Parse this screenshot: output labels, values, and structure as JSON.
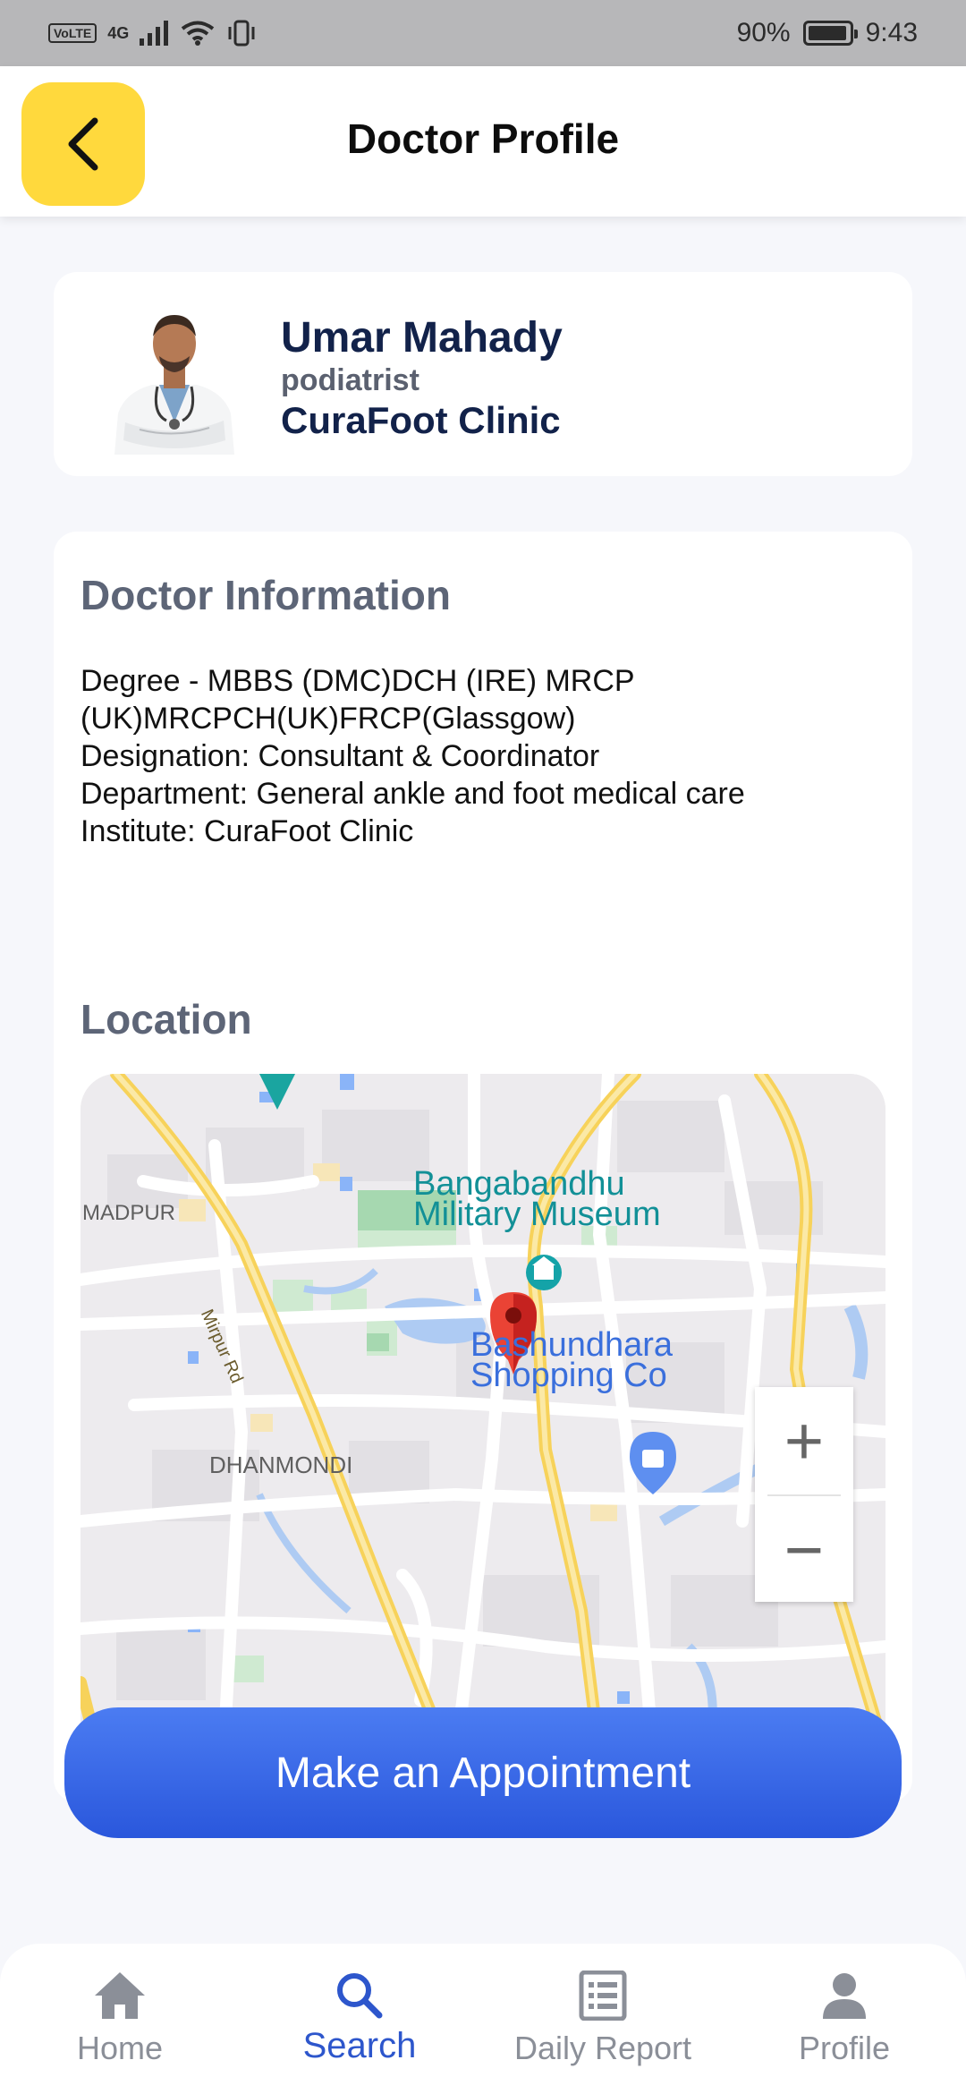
{
  "status_bar": {
    "volte": "VoLTE",
    "network": "4G",
    "battery": "90%",
    "time": "9:43"
  },
  "header": {
    "title": "Doctor Profile",
    "back_icon": "chevron-left-icon",
    "back_color": "#ffd93d"
  },
  "doctor": {
    "name": "Umar Mahady",
    "specialty": "podiatrist",
    "clinic": "CuraFoot Clinic"
  },
  "info": {
    "title": "Doctor Information",
    "lines": [
      "Degree - MBBS (DMC)DCH (IRE) MRCP",
      "(UK)MRCPCH(UK)FRCP(Glassgow)",
      "Designation: Consultant & Coordinator",
      "Department: General ankle and foot medical care",
      "Institute: CuraFoot Clinic"
    ]
  },
  "location": {
    "title": "Location",
    "map_labels": {
      "area_left": "MADPUR",
      "museum_1": "Bangabandhu",
      "museum_2": "Military Museum",
      "road": "Mirpur Rd",
      "mall_1": "Bashundhara",
      "mall_2": "Shopping Co",
      "area_bottom": "DHANMONDI"
    },
    "zoom_in": "+",
    "zoom_out": "−"
  },
  "appointment_button": {
    "label": "Make an Appointment",
    "color": "#3366e6"
  },
  "nav": {
    "items": [
      {
        "label": "Home",
        "icon": "home-icon"
      },
      {
        "label": "Search",
        "icon": "search-icon"
      },
      {
        "label": "Daily Report",
        "icon": "report-icon"
      },
      {
        "label": "Profile",
        "icon": "profile-icon"
      }
    ],
    "active_color": "#2d56cc"
  }
}
